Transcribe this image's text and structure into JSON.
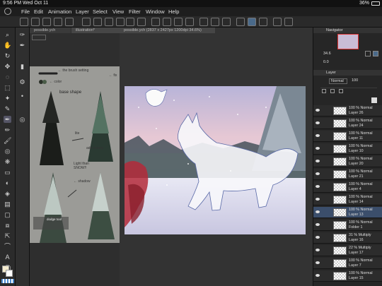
{
  "status": {
    "time": "9:56 PM",
    "date": "Wed Oct 11",
    "battery": "36%"
  },
  "menu": [
    "File",
    "Edit",
    "Animation",
    "Layer",
    "Select",
    "View",
    "Filter",
    "Window",
    "Help"
  ],
  "tabs": {
    "left": "possible.ych",
    "left2": "illustration*",
    "main": "possible.ych (2837 x 2427px 1200dpi 34.6%)"
  },
  "ref_notes": {
    "brush": "← the brush setting",
    "color": "← color",
    "base": "base shape",
    "fix": "← fix",
    "lite": "lite",
    "messy": "add messy",
    "snow": "Light than SNOW!!",
    "shadow": "← shadow",
    "dodge": "dodge tool"
  },
  "navigator": {
    "title": "Navigator",
    "zoom": "34.6",
    "angle": "0.0"
  },
  "layer_panel": {
    "title": "Layer",
    "blend": "Normal",
    "opacity": "100"
  },
  "layers": [
    {
      "pct": "100 %",
      "mode": "Normal",
      "name": "Layer 26"
    },
    {
      "pct": "100 %",
      "mode": "Normal",
      "name": "Layer 24"
    },
    {
      "pct": "100 %",
      "mode": "Normal",
      "name": "Layer 11"
    },
    {
      "pct": "100 %",
      "mode": "Normal",
      "name": "Layer 10"
    },
    {
      "pct": "100 %",
      "mode": "Normal",
      "name": "Layer 20"
    },
    {
      "pct": "100 %",
      "mode": "Normal",
      "name": "Layer 21"
    },
    {
      "pct": "100 %",
      "mode": "Normal",
      "name": "Layer 4"
    },
    {
      "pct": "100 %",
      "mode": "Normal",
      "name": "Layer 14"
    },
    {
      "pct": "100 %",
      "mode": "Normal",
      "name": "Layer 13"
    },
    {
      "pct": "100 %",
      "mode": "Normal",
      "name": "Folder 1"
    },
    {
      "pct": "31 %",
      "mode": "Multiply",
      "name": "Layer 16"
    },
    {
      "pct": "22 %",
      "mode": "Multiply",
      "name": "Layer 17"
    },
    {
      "pct": "100 %",
      "mode": "Normal",
      "name": "Layer 7"
    },
    {
      "pct": "100 %",
      "mode": "Normal",
      "name": "Layer 15"
    }
  ]
}
